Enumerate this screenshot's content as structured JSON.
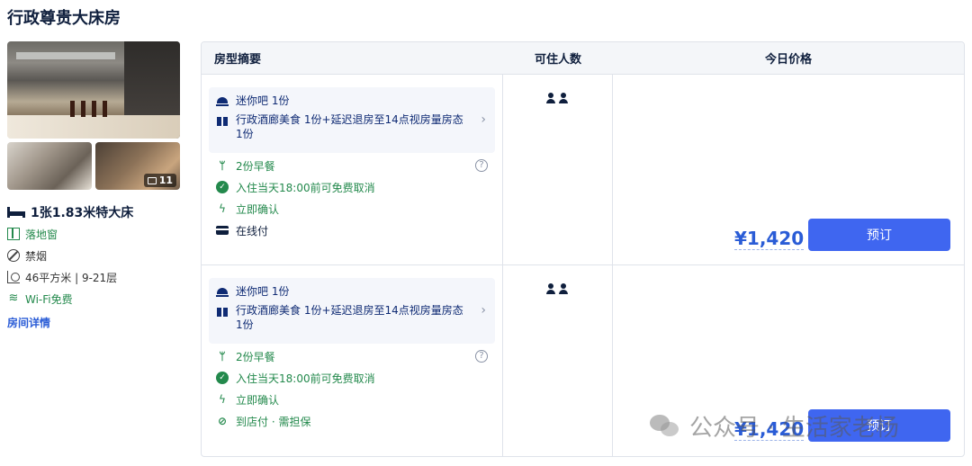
{
  "room": {
    "title": "行政尊贵大床房",
    "photo_count": "11",
    "bed": "1张1.83米特大床",
    "features": [
      {
        "icon": "window-icon",
        "text": "落地窗",
        "color": "#23894c"
      },
      {
        "icon": "no-smoking-icon",
        "text": "禁烟",
        "color": "#333333"
      },
      {
        "icon": "area-icon",
        "text": "46平方米 | 9-21层",
        "color": "#333333"
      },
      {
        "icon": "wifi-icon",
        "text": "Wi-Fi免费",
        "color": "#23894c"
      }
    ],
    "details_link": "房间详情"
  },
  "table": {
    "headers": [
      "房型摘要",
      "可住人数",
      "今日价格"
    ],
    "rows": [
      {
        "perks": [
          "迷你吧 1份",
          "行政酒廊美食 1份+延迟退房至14点视房量房态 1份"
        ],
        "policies": [
          {
            "icon": "fork-knife-icon",
            "text": "2份早餐",
            "color": "#23894c",
            "help": "?"
          },
          {
            "icon": "check-circle-icon",
            "text": "入住当天18:00前可免费取消",
            "color": "#23894c"
          },
          {
            "icon": "lightning-icon",
            "text": "立即确认",
            "color": "#23894c"
          },
          {
            "icon": "card-icon",
            "text": "在线付",
            "color": "#0f1f3d"
          }
        ],
        "guests": 2,
        "price": "¥1,420",
        "book": "预订"
      },
      {
        "perks": [
          "迷你吧 1份",
          "行政酒廊美食 1份+延迟退房至14点视房量房态 1份"
        ],
        "policies": [
          {
            "icon": "fork-knife-icon",
            "text": "2份早餐",
            "color": "#23894c",
            "help": "?"
          },
          {
            "icon": "check-circle-icon",
            "text": "入住当天18:00前可免费取消",
            "color": "#23894c"
          },
          {
            "icon": "lightning-icon",
            "text": "立即确认",
            "color": "#23894c"
          },
          {
            "icon": "pay-at-hotel-icon",
            "text": "到店付 · 需担保",
            "color": "#23894c"
          }
        ],
        "guests": 2,
        "price": "¥1,420",
        "book": "预订"
      }
    ]
  },
  "watermark": "公众号 · 生活家老杨",
  "colors": {
    "accent": "#3f66f0",
    "price": "#2a5cd6",
    "green": "#23894c",
    "text": "#0f1f3d"
  }
}
